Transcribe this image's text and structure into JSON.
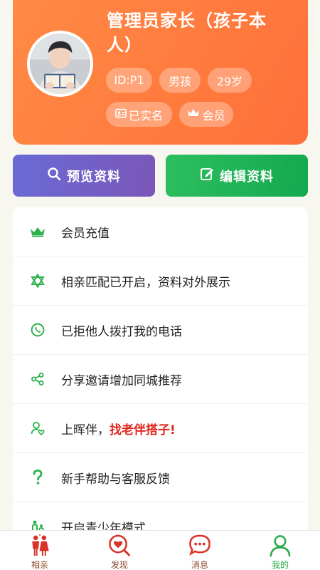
{
  "profile": {
    "name": "管理员家长（孩子本人）",
    "chips": {
      "id": "ID:P1",
      "gender": "男孩",
      "age": "29岁",
      "verified": "已实名",
      "member": "会员"
    }
  },
  "actions": {
    "preview": "预览资料",
    "edit": "编辑资料"
  },
  "menu": {
    "items": [
      {
        "icon": "crown-icon",
        "label": "会员充值"
      },
      {
        "icon": "star-of-david-icon",
        "label": "相亲匹配已开启，资料对外展示"
      },
      {
        "icon": "phone-icon",
        "label": "已拒他人拨打我的电话"
      },
      {
        "icon": "share-icon",
        "label": "分享邀请增加同城推荐"
      },
      {
        "icon": "user-heart-icon",
        "label": "上晖伴，",
        "highlight": "找老伴搭子!"
      },
      {
        "icon": "question-icon",
        "label": "新手帮助与客服反馈"
      },
      {
        "icon": "youth-mode-icon",
        "label": "开启青少年模式"
      }
    ]
  },
  "tabbar": {
    "tabs": [
      {
        "label": "相亲",
        "icon": "couple-icon"
      },
      {
        "label": "发现",
        "icon": "discover-icon"
      },
      {
        "label": "消息",
        "icon": "message-icon"
      },
      {
        "label": "我的",
        "icon": "profile-icon",
        "active": true
      }
    ]
  },
  "colors": {
    "header_orange": "#ff7a3d",
    "preview_purple": "#7460c8",
    "edit_green": "#18ad53",
    "menu_icon_green": "#2bb24c",
    "highlight_red": "#e0261b",
    "tab_red": "#d9342a",
    "tab_active_green": "#2aaa4a"
  }
}
